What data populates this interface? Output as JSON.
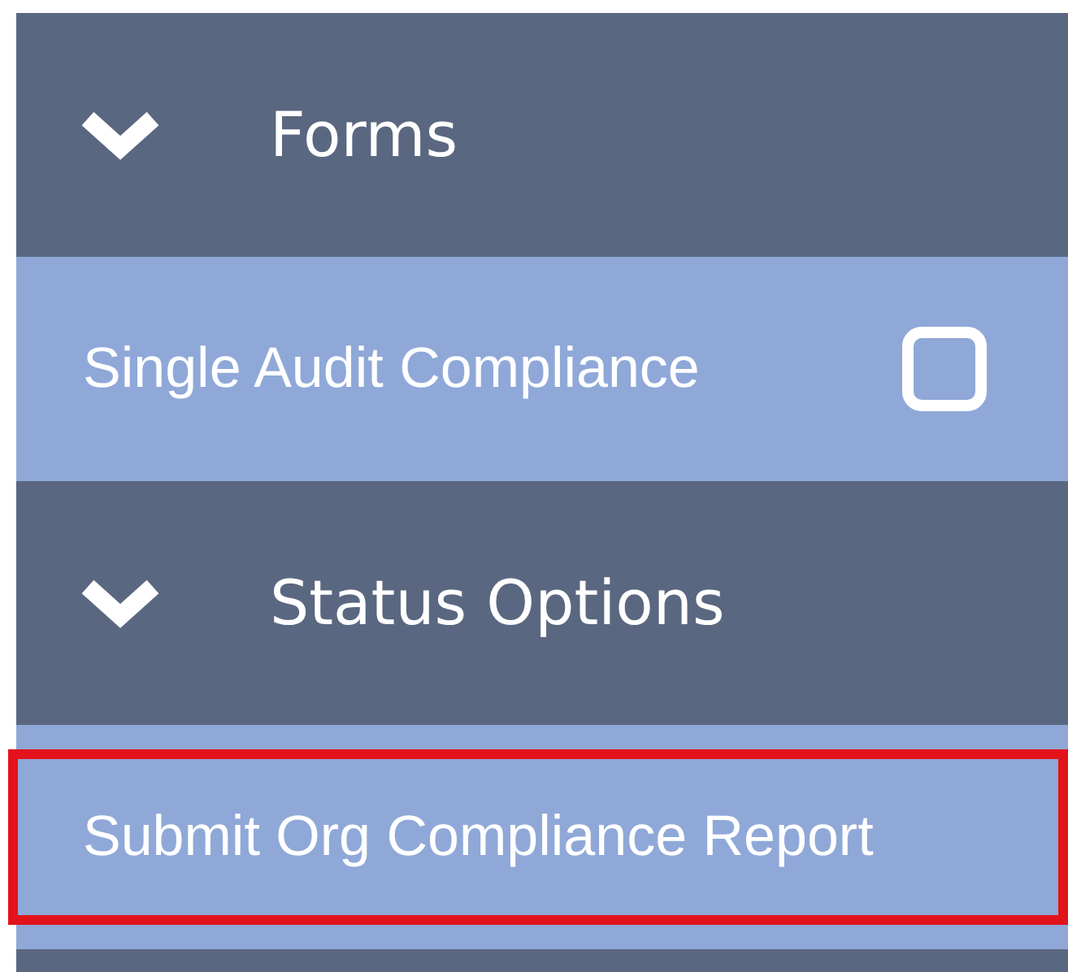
{
  "sections": [
    {
      "title": "Forms",
      "expanded": true,
      "items": [
        {
          "label": "Single Audit Compliance",
          "kind": "checkbox",
          "checked": false,
          "highlighted": false
        }
      ]
    },
    {
      "title": "Status Options",
      "expanded": true,
      "items": [
        {
          "label": "Submit Org Compliance Report",
          "kind": "link",
          "highlighted": true
        }
      ]
    }
  ]
}
